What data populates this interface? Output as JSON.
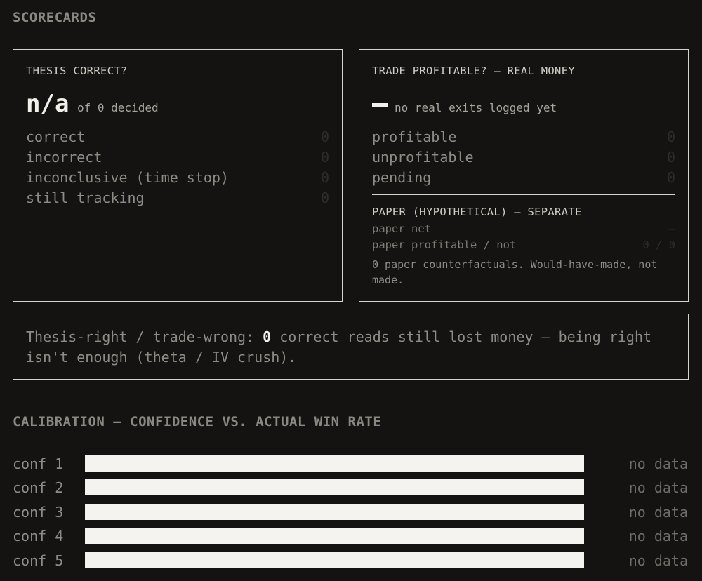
{
  "scorecards": {
    "title": "SCORECARDS",
    "thesis": {
      "title": "THESIS CORRECT?",
      "big_value": "n/a",
      "big_sub": "of 0 decided",
      "rows": [
        {
          "label": "correct",
          "value": "0"
        },
        {
          "label": "incorrect",
          "value": "0"
        },
        {
          "label": "inconclusive (time stop)",
          "value": "0"
        },
        {
          "label": "still tracking",
          "value": "0"
        }
      ]
    },
    "trade": {
      "title": "TRADE PROFITABLE? — REAL MONEY",
      "big_sub": "no real exits logged yet",
      "rows": [
        {
          "label": "profitable",
          "value": "0"
        },
        {
          "label": "unprofitable",
          "value": "0"
        },
        {
          "label": "pending",
          "value": "0"
        }
      ],
      "paper": {
        "title": "PAPER (HYPOTHETICAL) — SEPARATE",
        "net_label": "paper net",
        "net_value": "—",
        "profitable_label": "paper profitable / not",
        "profitable_value": "0 / 0",
        "note": "0 paper counterfactuals. Would-have-made, not made."
      }
    },
    "callout": {
      "prefix": "Thesis-right / trade-wrong: ",
      "count": "0",
      "suffix": " correct reads still lost money — being right isn't enough (theta / IV crush)."
    }
  },
  "calibration": {
    "title": "CALIBRATION — CONFIDENCE VS. ACTUAL WIN RATE",
    "rows": [
      {
        "label": "conf 1",
        "status": "no data",
        "win_rate": null
      },
      {
        "label": "conf 2",
        "status": "no data",
        "win_rate": null
      },
      {
        "label": "conf 3",
        "status": "no data",
        "win_rate": null
      },
      {
        "label": "conf 4",
        "status": "no data",
        "win_rate": null
      },
      {
        "label": "conf 5",
        "status": "no data",
        "win_rate": null
      }
    ]
  }
}
